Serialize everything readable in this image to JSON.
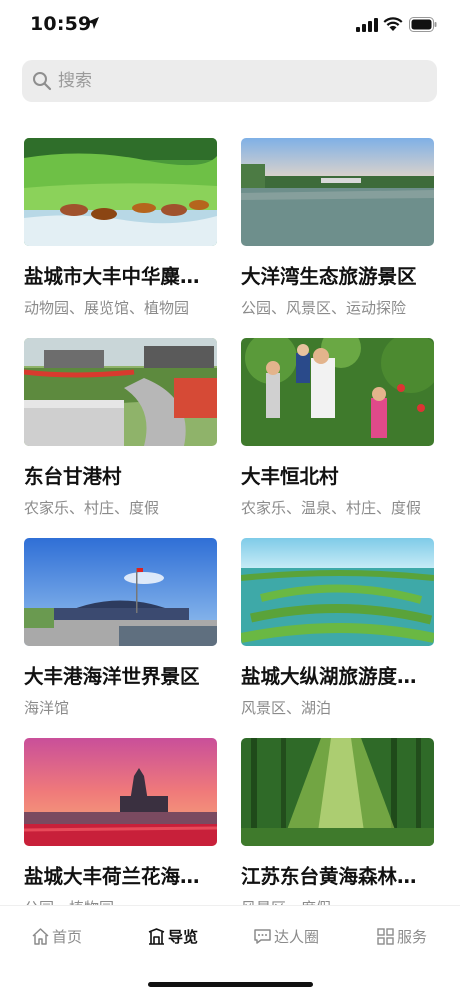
{
  "status_bar": {
    "time": "10:59"
  },
  "search": {
    "placeholder": "搜索"
  },
  "cards": [
    {
      "title": "盐城市大丰中华麋鹿园",
      "tags": "动物园、展览馆、植物园"
    },
    {
      "title": "大洋湾生态旅游景区",
      "tags": "公园、风景区、运动探险"
    },
    {
      "title": "东台甘港村",
      "tags": "农家乐、村庄、度假"
    },
    {
      "title": "大丰恒北村",
      "tags": "农家乐、温泉、村庄、度假"
    },
    {
      "title": "大丰港海洋世界景区",
      "tags": "海洋馆"
    },
    {
      "title": "盐城大纵湖旅游度假区",
      "tags": "风景区、湖泊"
    },
    {
      "title": "盐城大丰荷兰花海景区",
      "tags": "公园、植物园"
    },
    {
      "title": "江苏东台黄海森林公园",
      "tags": "风景区、度假"
    }
  ],
  "tab_bar": {
    "items": [
      {
        "label": "首页",
        "icon": "home-icon"
      },
      {
        "label": "导览",
        "icon": "gate-icon",
        "active": true
      },
      {
        "label": "达人圈",
        "icon": "chat-icon"
      },
      {
        "label": "服务",
        "icon": "grid-icon"
      }
    ]
  }
}
